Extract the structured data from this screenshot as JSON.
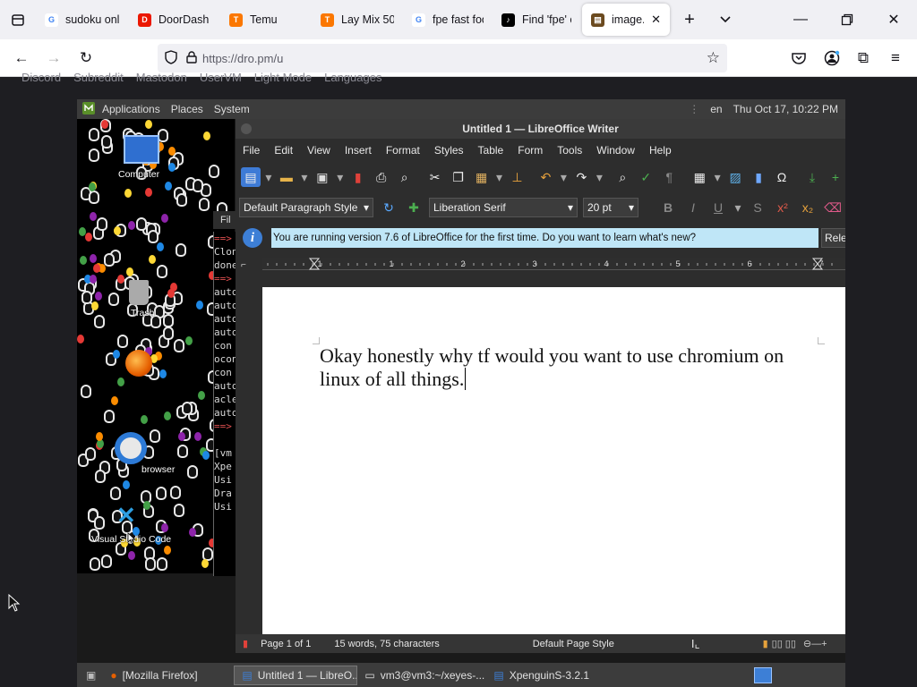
{
  "firefox": {
    "tabs": [
      {
        "label": "sudoku onl",
        "icon": "google-icon",
        "color": "#4285f4"
      },
      {
        "label": "DoorDash",
        "icon": "doordash-icon",
        "color": "#eb1700"
      },
      {
        "label": "Temu",
        "icon": "temu-icon",
        "color": "#fb7701"
      },
      {
        "label": "Lay Mix 50",
        "icon": "temu-icon",
        "color": "#fb7701"
      },
      {
        "label": "fpe fast foo",
        "icon": "google-icon",
        "color": "#4285f4"
      },
      {
        "label": "Find 'fpe' o",
        "icon": "tiktok-icon",
        "color": "#000000"
      },
      {
        "label": "image.pr",
        "icon": "image-icon",
        "color": "#6b4a1f",
        "active": true
      }
    ],
    "url": "https://dro.pm/u"
  },
  "site_nav": [
    "Discord",
    "Subreddit",
    "Mastodon",
    "UserVM",
    "Light Mode",
    "Languages"
  ],
  "vm": {
    "top_panel": {
      "menus": [
        "Applications",
        "Places",
        "System"
      ],
      "lang": "en",
      "clock": "Thu Oct 17, 10:22 PM"
    },
    "desktop_icons": [
      "Computer",
      "Trash",
      "Firefox",
      "browser",
      "Visual Studio Code"
    ],
    "terminal_lines": [
      "==>",
      "Clon",
      "done",
      "==>",
      "auto",
      "auto",
      "auto",
      "auto",
      "con",
      "ocon",
      "con",
      "auto",
      "acle",
      "auto",
      "==>",
      "",
      "[vm",
      "Xpe",
      "Usi",
      "Dra",
      "Usi"
    ],
    "writer": {
      "title": "Untitled 1 — LibreOffice Writer",
      "menu": [
        "File",
        "Edit",
        "View",
        "Insert",
        "Format",
        "Styles",
        "Table",
        "Form",
        "Tools",
        "Window",
        "Help"
      ],
      "paragraph_style": "Default Paragraph Style",
      "font_name": "Liberation Serif",
      "font_size": "20 pt",
      "infobar_text": "You are running version 7.6 of LibreOffice for the first time. Do you want to learn what's new?",
      "infobar_button": "Rele",
      "ruler_numbers": [
        "1",
        "1",
        "2",
        "3",
        "4",
        "5",
        "6",
        "7"
      ],
      "doc_text": "Okay honestly why tf would you want to use chromium on linux of all things.",
      "status": {
        "page": "Page 1 of 1",
        "words": "15 words, 75 characters",
        "style": "Default Page Style"
      }
    },
    "taskbar": [
      {
        "label": "[Mozilla Firefox]"
      },
      {
        "label": "Untitled 1 — LibreO...",
        "active": true
      },
      {
        "label": "vm3@vm3:~/xeyes-..."
      },
      {
        "label": "XpenguinS-3.2.1"
      }
    ]
  }
}
